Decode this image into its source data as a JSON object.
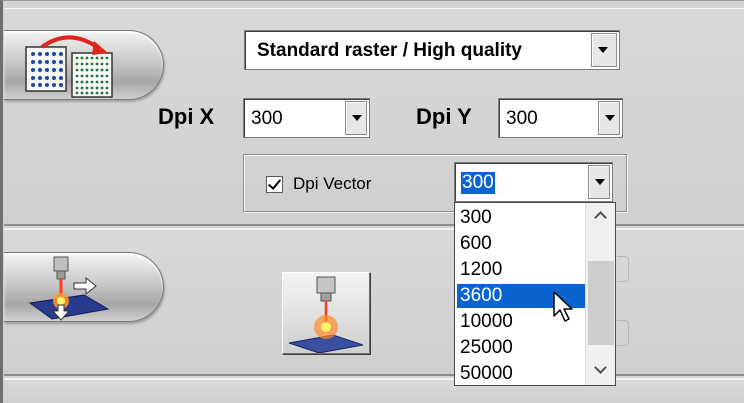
{
  "quality": {
    "selected": "Standard raster / High quality"
  },
  "dpi_x": {
    "label": "Dpi X",
    "value": "300"
  },
  "dpi_y": {
    "label": "Dpi Y",
    "value": "300"
  },
  "dpi_vector": {
    "checkbox_label": "Dpi Vector",
    "checked": true,
    "value": "300",
    "options": [
      "300",
      "600",
      "1200",
      "3600",
      "10000",
      "25000",
      "50000"
    ],
    "highlighted": "3600"
  },
  "icons": {
    "raster_mode": "raster-swap-icon",
    "laser_move": "laser-move-icon",
    "laser_focus": "laser-focus-icon"
  },
  "colors": {
    "selection": "#0a64d0",
    "panel": "#d4d4d4"
  }
}
